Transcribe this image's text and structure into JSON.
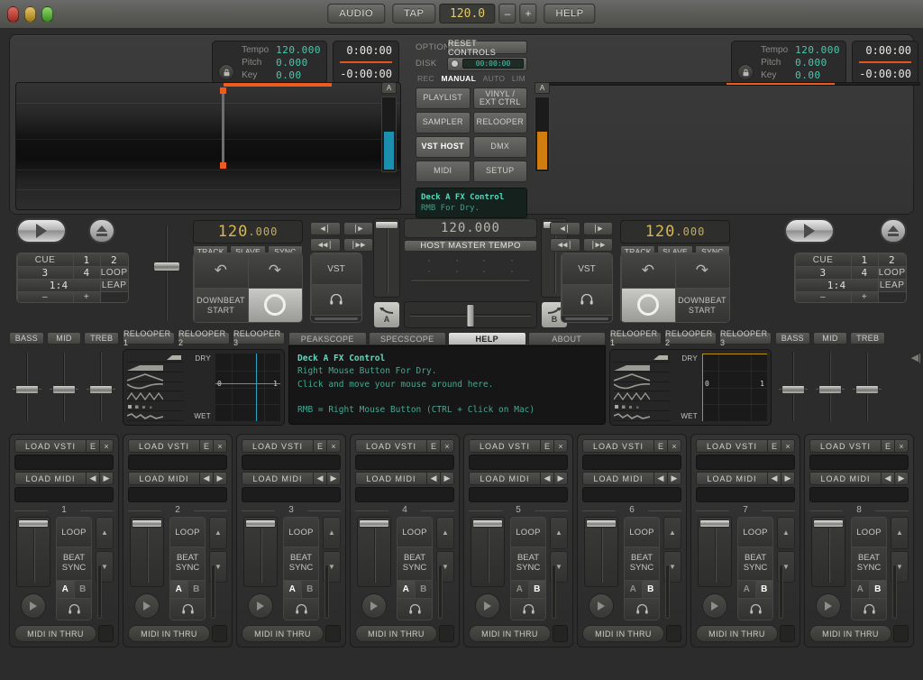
{
  "titlebar": {
    "audio_label": "AUDIO",
    "tap_label": "TAP",
    "tempo_value": "120.0",
    "minus_label": "–",
    "plus_label": "+",
    "help_label": "HELP"
  },
  "deck_a": {
    "info": {
      "tempo_label": "Tempo",
      "tempo_value": "120.000",
      "pitch_label": "Pitch",
      "pitch_value": "0.000",
      "key_label": "Key",
      "key_value": "0.00",
      "lock_icon": "🔒"
    },
    "time": {
      "elapsed": "0:00:00",
      "remaining": "-0:00:00"
    },
    "meter_label": "A",
    "meter_color": "#1b8fad",
    "bpm": {
      "whole": "120",
      "decimals": ".000"
    },
    "buttons": {
      "track": "TRACK",
      "slave": "SLAVE",
      "sync": "SYNC"
    },
    "nav": {
      "prev": "◀|",
      "next": "|▶",
      "rew": "◀◀|",
      "ffwd": "|▶▶"
    },
    "loop": {
      "downbeat": "DOWNBEAT",
      "start": "START",
      "undo": "↶",
      "redo": "↷"
    },
    "vst_label": "VST",
    "headphone_icon": "\u0001",
    "cue": {
      "cue_label": "CUE",
      "loop_label": "LOOP",
      "leap_label": "LEAP",
      "pads": [
        "1",
        "2",
        "3",
        "4"
      ],
      "loop_value": "1:4",
      "minus": "–",
      "plus": "+"
    }
  },
  "deck_b": {
    "info": {
      "tempo_label": "Tempo",
      "tempo_value": "120.000",
      "pitch_label": "Pitch",
      "pitch_value": "0.000",
      "key_label": "Key",
      "key_value": "0.00",
      "lock_icon": "🔒"
    },
    "time": {
      "elapsed": "0:00:00",
      "remaining": "-0:00:00"
    },
    "meter_label": "A",
    "meter_color": "#d07d10",
    "bpm": {
      "whole": "120",
      "decimals": ".000"
    },
    "buttons": {
      "track": "TRACK",
      "slave": "SLAVE",
      "sync": "SYNC"
    },
    "nav": {
      "prev": "◀|",
      "next": "|▶",
      "rew": "◀◀|",
      "ffwd": "|▶▶"
    },
    "loop": {
      "downbeat": "DOWNBEAT",
      "start": "START",
      "undo": "↶",
      "redo": "↷"
    },
    "vst_label": "VST",
    "cue": {
      "cue_label": "CUE",
      "loop_label": "LOOP",
      "leap_label": "LEAP",
      "pads": [
        "1",
        "2",
        "3",
        "4"
      ],
      "loop_value": "1:4",
      "minus": "–",
      "plus": "+"
    }
  },
  "center": {
    "option_label": "OPTION",
    "reset_label": "RESET CONTROLS",
    "disk_label": "DISK",
    "timecode": "00:00:00",
    "modes": [
      {
        "label": "REC",
        "active": false
      },
      {
        "label": "MANUAL",
        "active": true
      },
      {
        "label": "AUTO",
        "active": false
      },
      {
        "label": "LIM",
        "active": false
      }
    ],
    "nav_buttons": [
      {
        "label": "PLAYLIST",
        "active": false
      },
      {
        "label": "VINYL /\nEXT CTRL",
        "active": false
      },
      {
        "label": "SAMPLER",
        "active": false
      },
      {
        "label": "RELOOPER",
        "active": false
      },
      {
        "label": "VST HOST",
        "active": true
      },
      {
        "label": "DMX",
        "active": false
      },
      {
        "label": "MIDI",
        "active": false
      },
      {
        "label": "SETUP",
        "active": false
      }
    ],
    "lcd_line1": "Deck A FX Control",
    "lcd_line2": "RMB For Dry."
  },
  "mixer": {
    "host_tempo_value": "120.000",
    "host_tempo_label": "HOST MASTER TEMPO",
    "cue_a_label": "A",
    "cue_b_label": "B"
  },
  "eq_left": {
    "tabs": [
      "BASS",
      "MID",
      "TREB"
    ]
  },
  "eq_right": {
    "tabs": [
      "BASS",
      "MID",
      "TREB"
    ]
  },
  "relooper_left": {
    "tabs": [
      "RELOOPER 1",
      "RELOOPER 2",
      "RELOOPER 3"
    ],
    "dry_label": "DRY",
    "wet_label": "WET",
    "axis_min": "0",
    "axis_max": "1",
    "accent": "#2aa5c8"
  },
  "relooper_right": {
    "tabs": [
      "RELOOPER 1",
      "RELOOPER 2",
      "RELOOPER 3"
    ],
    "dry_label": "DRY",
    "wet_label": "WET",
    "axis_min": "0",
    "axis_max": "1",
    "accent": "#bd8c12"
  },
  "help_panel": {
    "tabs": [
      {
        "label": "PEAKSCOPE",
        "active": false
      },
      {
        "label": "SPECSCOPE",
        "active": false
      },
      {
        "label": "HELP",
        "active": true
      },
      {
        "label": "ABOUT",
        "active": false
      }
    ],
    "line1": "Deck A FX Control",
    "line2": "Right Mouse Button For Dry.",
    "line3": "Click and move your mouse around here.",
    "line4": "",
    "line5": "RMB = Right Mouse Button  (CTRL + Click on Mac)"
  },
  "strip_common": {
    "load_vsti": "LOAD VSTI",
    "edit_label": "E",
    "close_label": "×",
    "load_midi": "LOAD MIDI",
    "prev_arrow": "◀",
    "next_arrow": "▶",
    "loop_label": "LOOP",
    "beat_sync_label": "BEAT\nSYNC",
    "beat_sync_line1": "BEAT",
    "beat_sync_line2": "SYNC",
    "a_label": "A",
    "b_label": "B",
    "headphone_label": "○",
    "up_arrow": "▲",
    "down_arrow": "▼",
    "midi_in_thru": "MIDI IN THRU"
  },
  "strips": [
    {
      "number": "1",
      "active_out": "A"
    },
    {
      "number": "2",
      "active_out": "A"
    },
    {
      "number": "3",
      "active_out": "A"
    },
    {
      "number": "4",
      "active_out": "A"
    },
    {
      "number": "5",
      "active_out": "B"
    },
    {
      "number": "6",
      "active_out": "B"
    },
    {
      "number": "7",
      "active_out": "B"
    },
    {
      "number": "8",
      "active_out": "B"
    }
  ],
  "edge": {
    "collapse_arrow": "◀|"
  }
}
